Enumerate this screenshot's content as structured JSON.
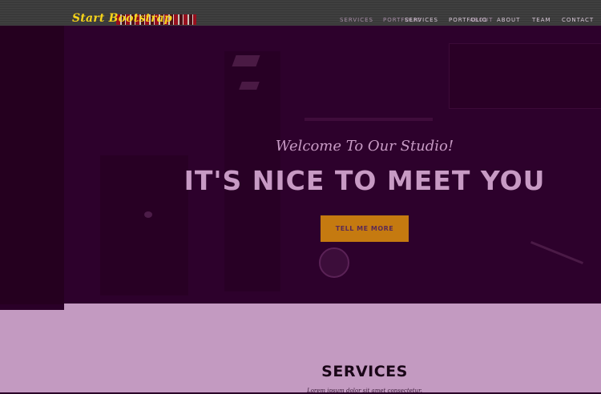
{
  "navbar": {
    "brand": "Start Bootstrap",
    "links": [
      "Services",
      "Portfolio",
      "About",
      "Team",
      "Contact"
    ],
    "ghost_links": [
      "Services",
      "Portfolio",
      "About"
    ]
  },
  "hero": {
    "lead": "Welcome To Our Studio!",
    "heading": "IT'S NICE TO MEET YOU",
    "button_label": "Tell Me More"
  },
  "services": {
    "heading": "SERVICES",
    "subheading": "Lorem ipsum dolor sit amet consectetur."
  },
  "colors": {
    "accent": "#c57a10",
    "hero_bg": "#2d012c",
    "section_bg": "#c39ac1",
    "brand_yellow": "#f5d31a"
  }
}
